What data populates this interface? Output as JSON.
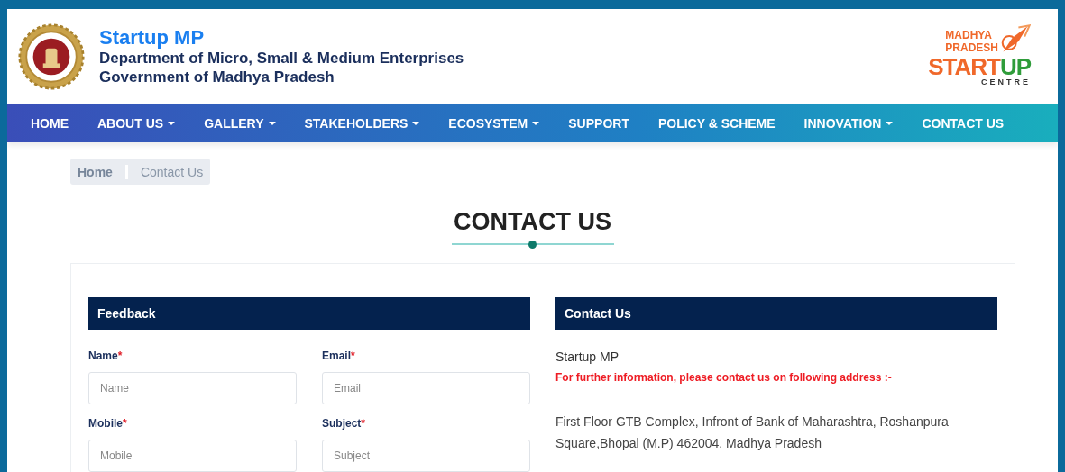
{
  "header": {
    "title": "Startup MP",
    "subtitle_lines": [
      "Department of Micro, Small & Medium Enterprises",
      "Government of Madhya Pradesh"
    ],
    "logo_lines": [
      "MADHYA",
      "PRADESH",
      "START",
      "UP",
      "CENTRE"
    ]
  },
  "nav": [
    {
      "label": "HOME",
      "has_menu": false
    },
    {
      "label": "ABOUT US",
      "has_menu": true
    },
    {
      "label": "GALLERY",
      "has_menu": true
    },
    {
      "label": "STAKEHOLDERS",
      "has_menu": true
    },
    {
      "label": "ECOSYSTEM",
      "has_menu": true
    },
    {
      "label": "SUPPORT",
      "has_menu": false
    },
    {
      "label": "POLICY & SCHEME",
      "has_menu": false
    },
    {
      "label": "INNOVATION",
      "has_menu": true
    },
    {
      "label": "CONTACT US",
      "has_menu": false
    }
  ],
  "breadcrumb": [
    {
      "label": "Home",
      "selected": false
    },
    {
      "label": "Contact Us",
      "selected": true
    }
  ],
  "page_title": "CONTACT US",
  "feedback": {
    "heading": "Feedback",
    "fields": [
      {
        "label": "Name",
        "required": true,
        "required_mark": "*",
        "placeholder": "Name"
      },
      {
        "label": "Email",
        "required": true,
        "required_mark": "*",
        "placeholder": "Email"
      },
      {
        "label": "Mobile",
        "required": true,
        "required_mark": "*",
        "placeholder": "Mobile"
      },
      {
        "label": "Subject",
        "required": true,
        "required_mark": "*",
        "placeholder": "Subject"
      }
    ]
  },
  "contact": {
    "heading": "Contact Us",
    "org": "Startup MP",
    "notice": "For further information, please contact us on following address :-",
    "address": "First Floor GTB Complex, Infront of Bank of Maharashtra, Roshanpura Square,Bhopal (M.P) 462004, Madhya Pradesh"
  }
}
